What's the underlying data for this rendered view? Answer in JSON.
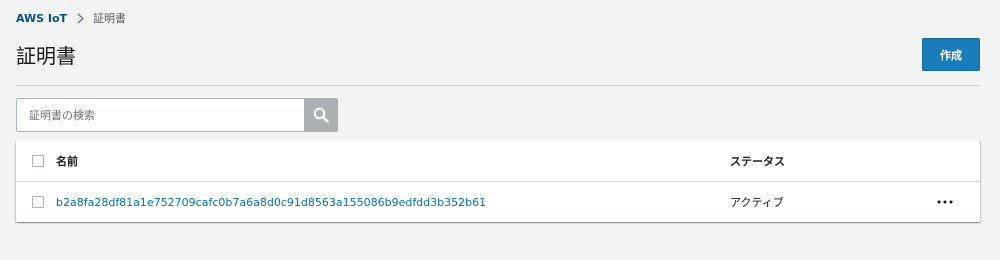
{
  "breadcrumb": {
    "root": "AWS IoT",
    "current": "証明書"
  },
  "page": {
    "title": "証明書",
    "create_label": "作成"
  },
  "search": {
    "placeholder": "証明書の検索"
  },
  "table": {
    "columns": {
      "name": "名前",
      "status": "ステータス"
    },
    "rows": [
      {
        "name": "b2a8fa28df81a1e752709cafc0b7a6a8d0c91d8563a155086b9edfdd3b352b61",
        "status": "アクティブ"
      }
    ]
  },
  "colors": {
    "primary_button": "#1a7dbb",
    "link": "#0073bb",
    "background": "#f2f3f3"
  }
}
